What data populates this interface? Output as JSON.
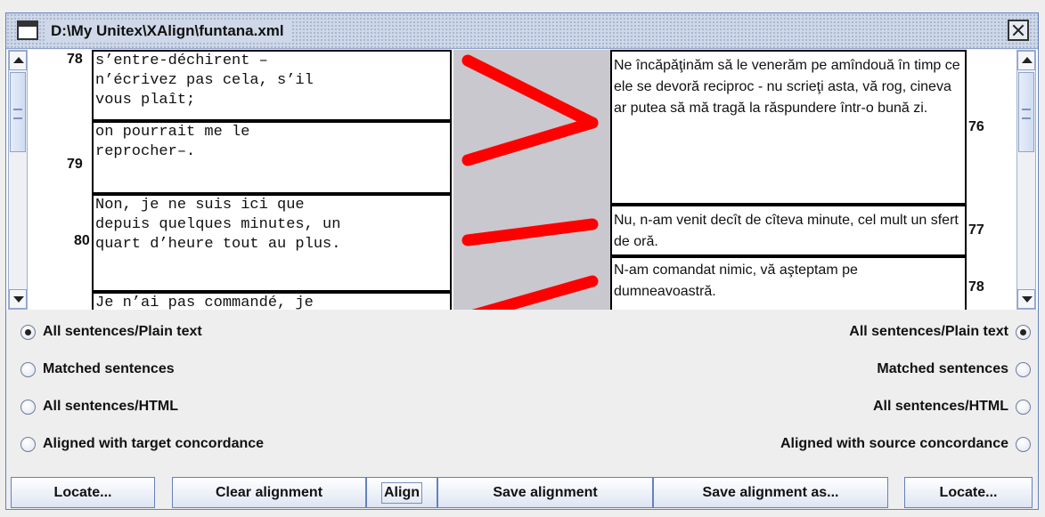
{
  "window": {
    "title": "D:\\My Unitex\\XAlign\\funtana.xml"
  },
  "source": [
    {
      "num": "78",
      "text": "s’entre-déchirent –\nn’écrivez pas cela, s’il\nvous plaît;"
    },
    {
      "num": "79",
      "text": "on pourrait me le\nreprocher–."
    },
    {
      "num": "80",
      "text": "Non, je ne suis ici que\ndepuis quelques minutes, un\nquart d’heure tout au plus."
    },
    {
      "num": "",
      "text": "Je n’ai pas commandé, je"
    }
  ],
  "target": [
    {
      "num": "76",
      "text": "Ne încăpăţinăm să le venerăm pe amîndouă în timp ce ele se devoră reciproc - nu scrieţi asta, vă rog, cineva ar putea să mă tragă la răspundere într-o bună zi."
    },
    {
      "num": "77",
      "text": "Nu, n-am venit decît de cîteva minute, cel mult un sfert de oră."
    },
    {
      "num": "78",
      "text": "N-am comandat nimic, vă aşteptam pe dumneavoastră."
    }
  ],
  "left_options": [
    {
      "label": "All sentences/Plain text",
      "checked": true
    },
    {
      "label": "Matched sentences",
      "checked": false
    },
    {
      "label": "All sentences/HTML",
      "checked": false
    },
    {
      "label": "Aligned with target concordance",
      "checked": false
    }
  ],
  "right_options": [
    {
      "label": "All sentences/Plain text",
      "checked": true
    },
    {
      "label": "Matched sentences",
      "checked": false
    },
    {
      "label": "All sentences/HTML",
      "checked": false
    },
    {
      "label": "Aligned with source concordance",
      "checked": false
    }
  ],
  "buttons": {
    "locate_left": "Locate...",
    "clear_alignment": "Clear alignment",
    "align": "Align",
    "save_alignment": "Save alignment",
    "save_alignment_as": "Save alignment as...",
    "locate_right": "Locate..."
  },
  "colors": {
    "link_line": "#ff0000",
    "gutter": "#c8c8ce",
    "frame_border": "#6382bf"
  }
}
